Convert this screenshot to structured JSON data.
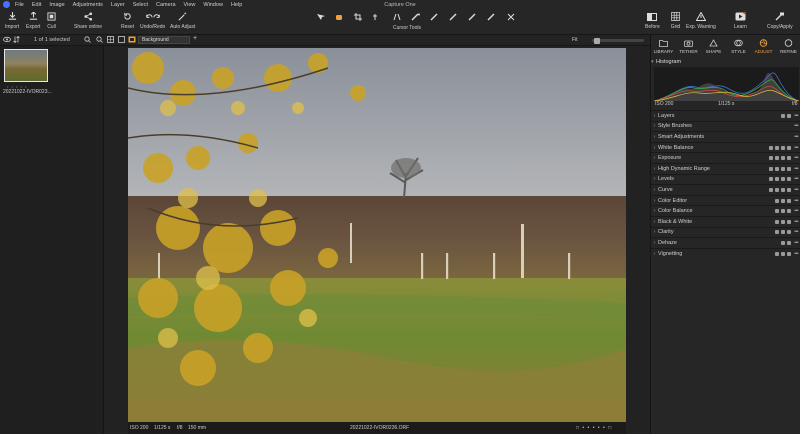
{
  "window": {
    "title": "Capture One"
  },
  "menu": [
    "File",
    "Edit",
    "Image",
    "Adjustments",
    "Layer",
    "Select",
    "Camera",
    "View",
    "Window",
    "Help"
  ],
  "toolbar": {
    "import": "Import",
    "export": "Export",
    "cull": "Cull",
    "share_online": "Share online",
    "reset": "Reset",
    "undo_redo": "Undo/Redo",
    "auto_adjust": "Auto Adjust",
    "cursor_tools": "Cursor Tools",
    "before": "Before",
    "grid": "Grid",
    "exp_warning": "Exp. Warning",
    "learn": "Learn",
    "copy_apply": "Copy/Apply"
  },
  "subbar": {
    "selection": "1 of 1 selected",
    "layer": "Background",
    "zoom_mode": "Fit",
    "zoom_fraction": 0.05
  },
  "browser": {
    "filename": "20221022-IVOR023...",
    "rating_dots": "• • • • •"
  },
  "viewer": {
    "iso": "ISO 200",
    "shutter": "1/125 s",
    "aperture": "f/8",
    "focal": "150 mm",
    "filename": "20221022-IVOR0236.ORF"
  },
  "tool_tabs": [
    {
      "label": "LIBRARY",
      "icon": "folder-icon"
    },
    {
      "label": "TETHER",
      "icon": "camera-icon"
    },
    {
      "label": "SHAPE",
      "icon": "shape-icon"
    },
    {
      "label": "STYLE",
      "icon": "style-icon"
    },
    {
      "label": "ADJUST",
      "icon": "aperture-icon"
    },
    {
      "label": "REFINE",
      "icon": "circle-icon"
    }
  ],
  "histogram": {
    "title": "Histogram",
    "iso": "ISO 200",
    "shutter": "1/125 s",
    "aperture": "f/8"
  },
  "panels": [
    {
      "name": "Layers",
      "icons": 2
    },
    {
      "name": "Style Brushes",
      "icons": 0
    },
    {
      "name": "Smart Adjustments",
      "icons": 0
    },
    {
      "name": "White Balance",
      "icons": 4
    },
    {
      "name": "Exposure",
      "icons": 4
    },
    {
      "name": "High Dynamic Range",
      "icons": 4
    },
    {
      "name": "Levels",
      "icons": 4
    },
    {
      "name": "Curve",
      "icons": 4
    },
    {
      "name": "Color Editor",
      "icons": 3
    },
    {
      "name": "Color Balance",
      "icons": 3
    },
    {
      "name": "Black & White",
      "icons": 3
    },
    {
      "name": "Clarity",
      "icons": 3
    },
    {
      "name": "Dehaze",
      "icons": 2
    },
    {
      "name": "Vignetting",
      "icons": 3
    }
  ],
  "colors": {
    "accent": "#f0a040",
    "logo": "#4d6fff",
    "panel_bg": "#262626"
  }
}
